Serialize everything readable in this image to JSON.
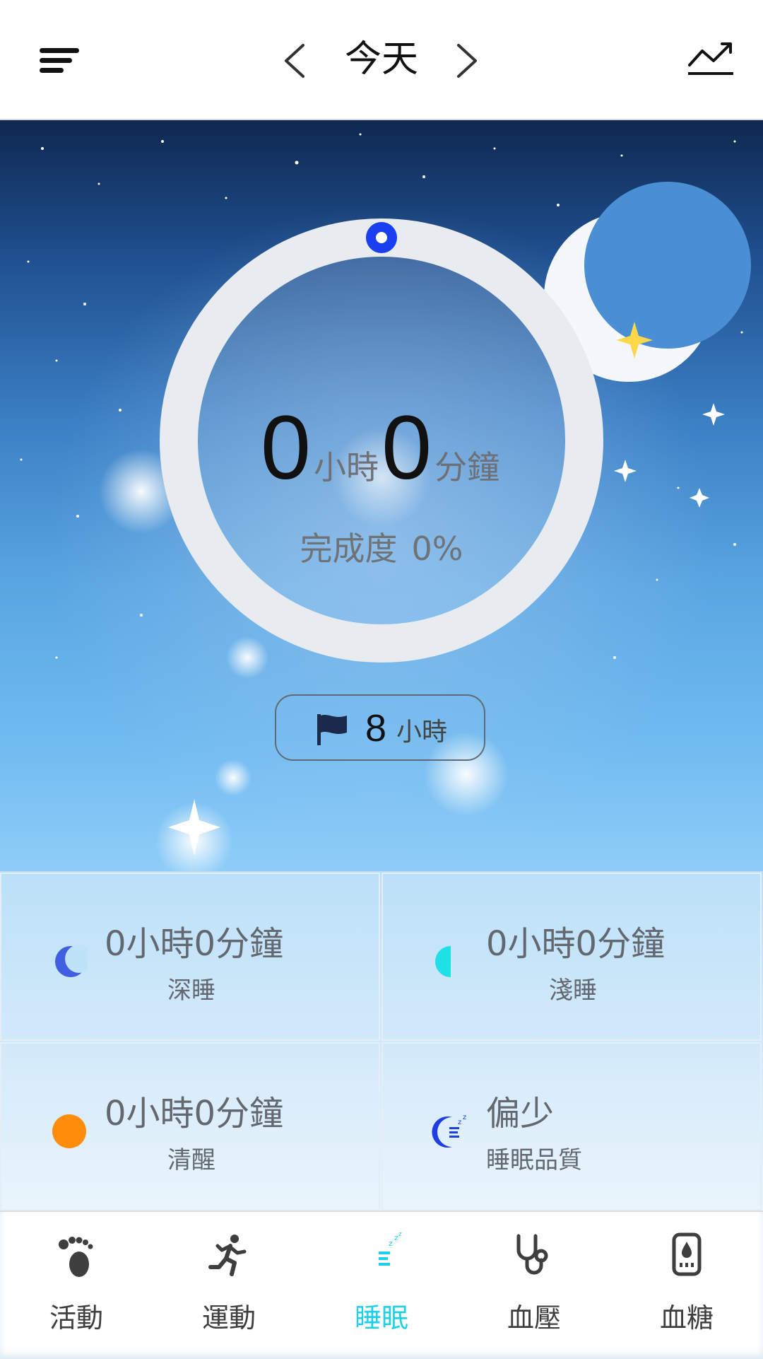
{
  "header": {
    "date_title": "今天",
    "prev_icon": "chevron-left-icon",
    "next_icon": "chevron-right-icon",
    "menu_icon": "menu-icon",
    "trend_icon": "trend-icon"
  },
  "summary": {
    "hours": "0",
    "hours_unit": "小時",
    "minutes": "0",
    "minutes_unit": "分鐘",
    "completion_label": "完成度",
    "completion_value": "0%",
    "completion_fraction": 0
  },
  "goal": {
    "flag_icon": "flag-icon",
    "value": "8",
    "unit": "小時"
  },
  "stats": [
    {
      "value": "0小時0分鐘",
      "label": "深睡",
      "icon": "crescent-moon-icon",
      "color": "#3f5fe0"
    },
    {
      "value": "0小時0分鐘",
      "label": "淺睡",
      "icon": "half-circle-icon",
      "color": "#1fe0e6"
    },
    {
      "value": "0小時0分鐘",
      "label": "清醒",
      "icon": "orange-dot-icon",
      "color": "#ff8c0a"
    },
    {
      "value": "偏少",
      "label": "睡眠品質",
      "icon": "sleep-quality-icon",
      "color": "#1f3fe6"
    }
  ],
  "nav": {
    "items": [
      {
        "label": "活動",
        "icon": "footprint-icon",
        "active": false
      },
      {
        "label": "運動",
        "icon": "running-icon",
        "active": false
      },
      {
        "label": "睡眠",
        "icon": "sleep-moon-icon",
        "active": true
      },
      {
        "label": "血壓",
        "icon": "stethoscope-icon",
        "active": false
      },
      {
        "label": "血糖",
        "icon": "glucose-meter-icon",
        "active": false
      }
    ]
  },
  "colors": {
    "accent": "#1fd0ea",
    "ring_track": "#e8ebf0",
    "ring_marker": "#1a3ff0"
  }
}
